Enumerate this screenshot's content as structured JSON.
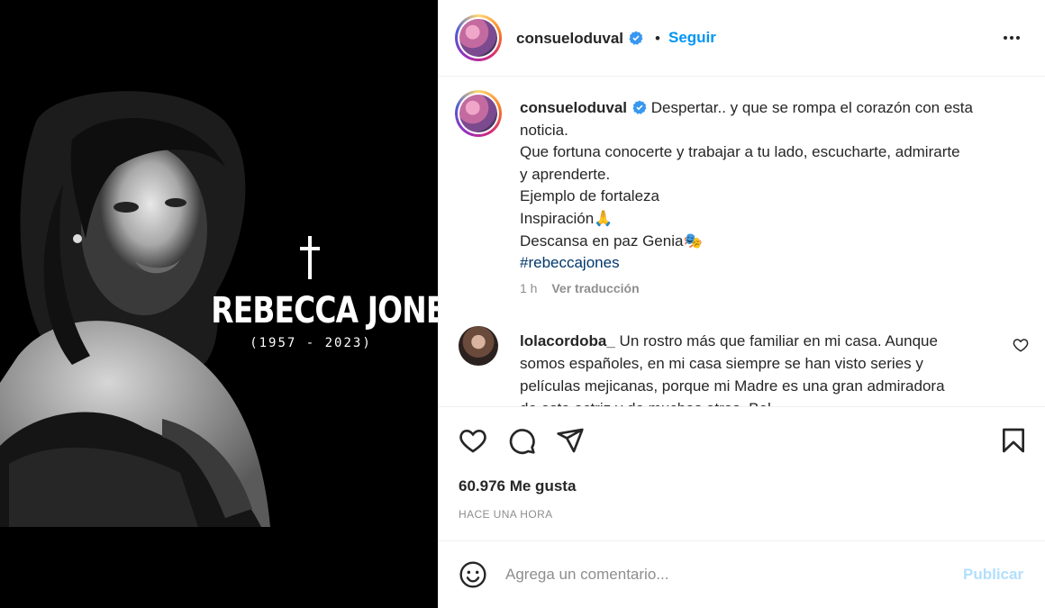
{
  "post_image": {
    "name": "REBECCA JONES",
    "years": "(1957 - 2023)"
  },
  "header": {
    "username": "consueloduval",
    "follow_label": "Seguir"
  },
  "caption": {
    "username": "consueloduval",
    "lines": [
      "Despertar.. y que se rompa el corazón con esta",
      "noticia.",
      "Que fortuna conocerte y trabajar a tu lado, escucharte, admirarte",
      "y aprenderte.",
      "Ejemplo de fortaleza",
      "Inspiración🙏",
      "Descansa en paz Genia🎭"
    ],
    "hashtag": "#rebeccajones",
    "time": "1 h",
    "translate_label": "Ver traducción"
  },
  "comment": {
    "username": "lolacordoba_",
    "lines": [
      "Un rostro más que familiar en mi casa. Aunque",
      "somos españoles, en mi casa siempre se han visto series y",
      "películas mejicanas, porque mi Madre es una gran admiradora",
      "de esta actriz y de muchas otras. Bel..."
    ]
  },
  "stats": {
    "likes": "60.976 Me gusta",
    "time_ago": "HACE UNA HORA"
  },
  "comment_box": {
    "placeholder": "Agrega un comentario...",
    "publish_label": "Publicar"
  },
  "colors": {
    "link_blue": "#0095f6",
    "publish_disabled": "#b2dffc",
    "hashtag": "#00376b",
    "muted": "#8e8e8e"
  },
  "icons": [
    "verified-badge-icon",
    "more-options-icon",
    "heart-icon",
    "comment-icon",
    "share-icon",
    "bookmark-icon",
    "emoji-icon",
    "comment-heart-icon"
  ]
}
